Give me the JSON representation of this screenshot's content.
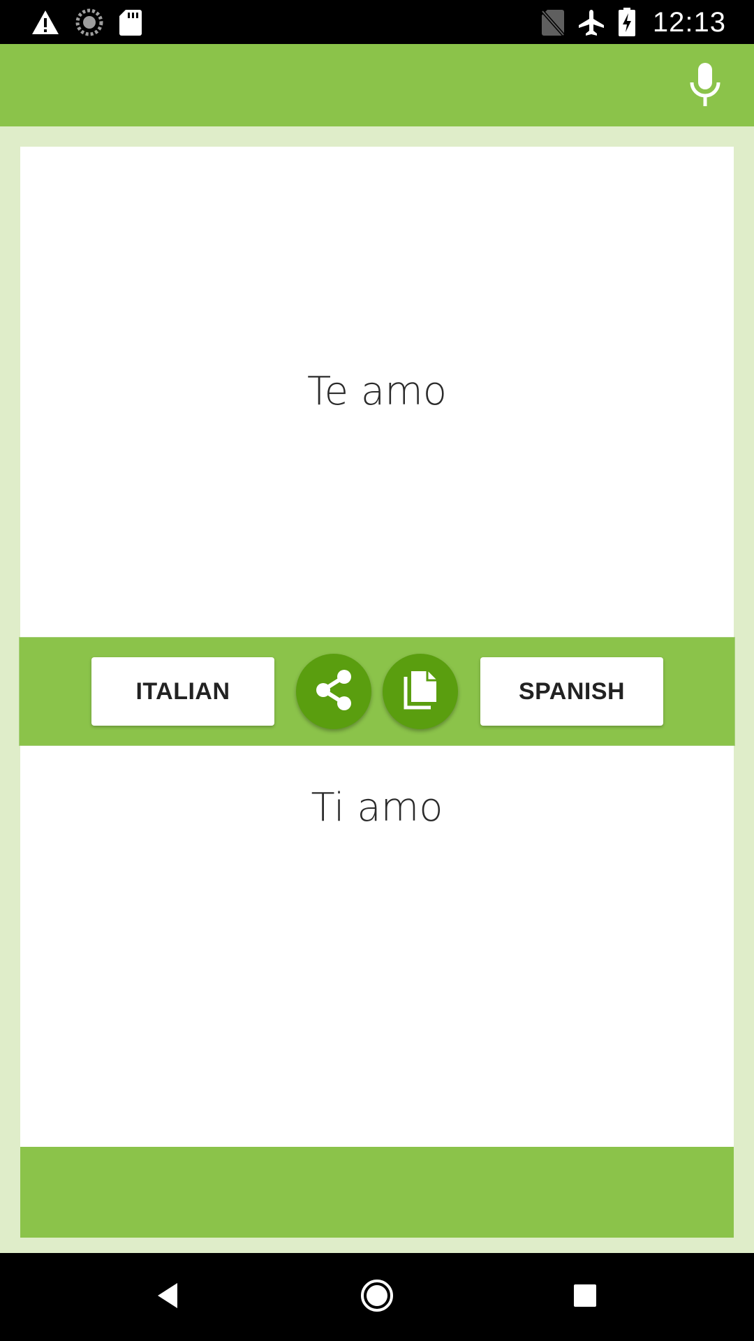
{
  "status_bar": {
    "time": "12:13",
    "left_icons": [
      "warning-icon",
      "sync-icon",
      "sd-card-icon"
    ],
    "right_icons": [
      "no-sim-icon",
      "airplane-mode-icon",
      "battery-charging-icon"
    ]
  },
  "app_bar": {
    "mic_icon": "microphone-icon"
  },
  "source": {
    "text": "Te amo"
  },
  "controls": {
    "source_language": "ITALIAN",
    "target_language": "SPANISH",
    "share_icon": "share-icon",
    "copy_icon": "copy-icon"
  },
  "target": {
    "text": "Ti amo"
  },
  "nav_bar": {
    "icons": [
      "back-icon",
      "home-icon",
      "recents-icon"
    ]
  },
  "colors": {
    "primary": "#8bc34a",
    "primary_dark": "#5a9e0f",
    "background": "#dfedc9",
    "surface": "#ffffff",
    "text": "#2b2b2b"
  }
}
